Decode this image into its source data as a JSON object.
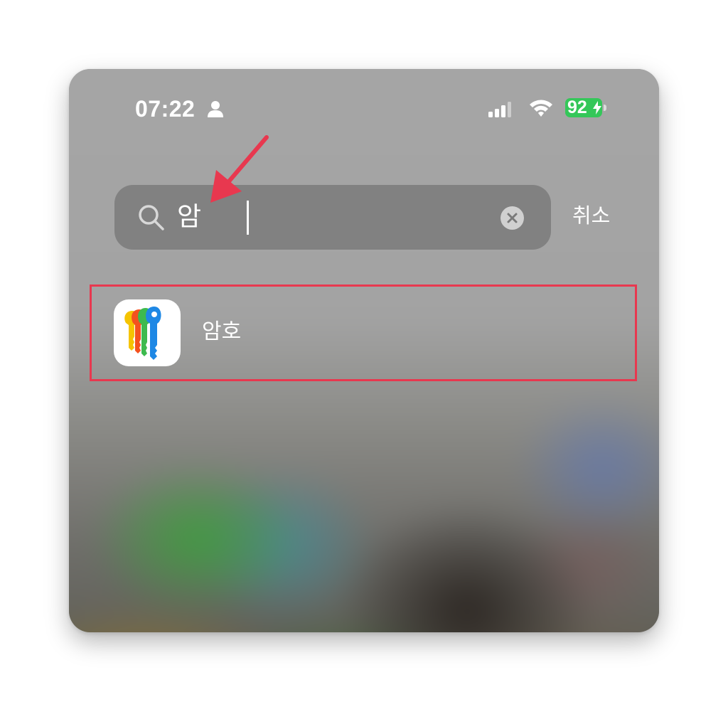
{
  "status_bar": {
    "time": "07:22",
    "battery_level": "92",
    "icons": [
      "person-icon",
      "cellular-signal-icon",
      "wifi-icon",
      "battery-charging-icon"
    ],
    "battery_color": "#34c759"
  },
  "search": {
    "value": "암",
    "clear_icon": "clear-icon",
    "cancel_label": "취소"
  },
  "results": [
    {
      "label": "암호",
      "icon": "passwords-app-icon"
    }
  ],
  "annotation": {
    "highlight_color": "#e8384f",
    "arrow_color": "#e8384f"
  }
}
